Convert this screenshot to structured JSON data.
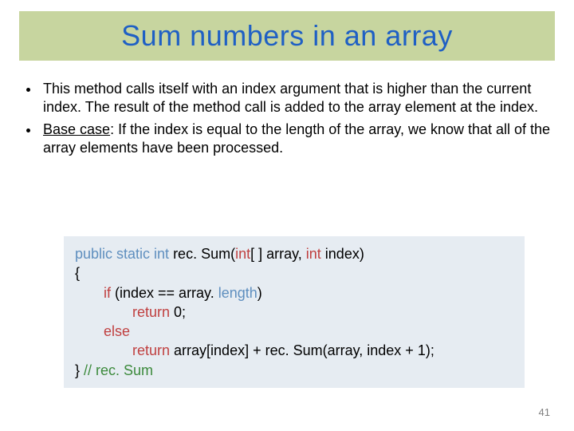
{
  "title": "Sum numbers in an array",
  "bullets": [
    {
      "text": "This method calls itself with an index argument that is higher than the current index.  The result of the method call is added to the array element at the index."
    },
    {
      "label": "Base case",
      "text": ": If the index is equal to the length of the array, we know that all of the array elements have been processed."
    }
  ],
  "code": {
    "sig_mods": "public static int ",
    "sig_name": "rec. Sum(",
    "sig_param_type": "int",
    "sig_param_rest": "[ ] array, ",
    "sig_param_type2": "int",
    "sig_param_rest2": " index)",
    "open_brace": "{",
    "if_kw": "if",
    "if_cond_a": " (index == array. ",
    "if_cond_len": "length",
    "if_cond_b": ")",
    "ret0_kw": "return",
    "ret0_rest": " 0;",
    "else_kw": "else",
    "ret1_kw": "return",
    "ret1_rest": " array[index] + rec. Sum(array, index + 1);",
    "close": "} ",
    "comment": "// rec. Sum"
  },
  "page_number": "41"
}
